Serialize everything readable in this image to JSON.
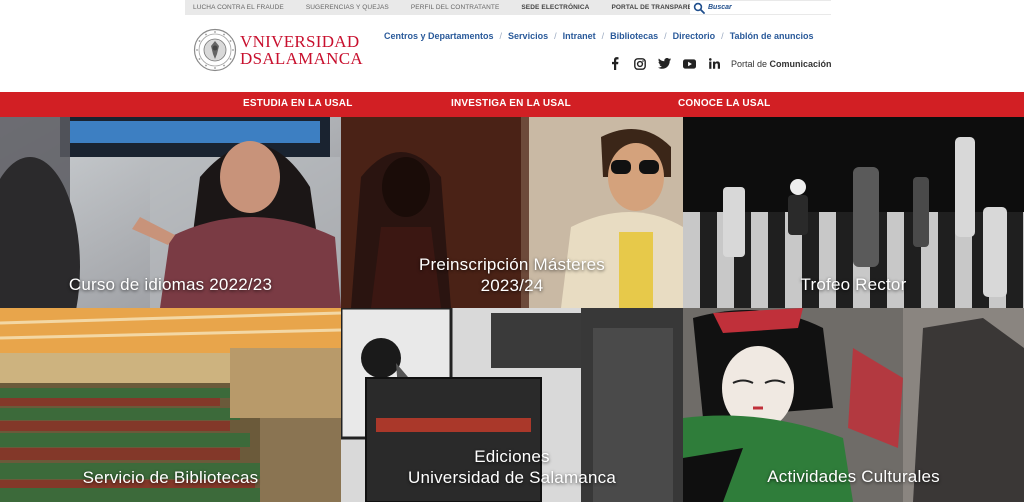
{
  "topbar": {
    "links": [
      "LUCHA CONTRA EL FRAUDE",
      "SUGERENCIAS Y QUEJAS",
      "PERFIL DEL CONTRATANTE",
      "SEDE ELECTRÓNICA",
      "PORTAL DE TRANSPARENCIA"
    ],
    "search_placeholder": "Buscar"
  },
  "logo": {
    "line1": "VNIVERSIDAD",
    "line2": "DSALAMANCA"
  },
  "main_nav": [
    "Centros y Departamentos",
    "Servicios",
    "Intranet",
    "Bibliotecas",
    "Directorio",
    "Tablón de anuncios"
  ],
  "socials": [
    "facebook-icon",
    "instagram-icon",
    "twitter-icon",
    "youtube-icon",
    "linkedin-icon"
  ],
  "portal": {
    "prefix": "Portal de",
    "bold": "Comunicación"
  },
  "red_nav": [
    "ESTUDIA EN LA USAL",
    "INVESTIGA EN LA USAL",
    "CONOCE LA USAL"
  ],
  "tiles": [
    {
      "line1": "Curso de idiomas 2022/23",
      "line2": ""
    },
    {
      "line1": "Preinscripción Másteres",
      "line2": "2023/24"
    },
    {
      "line1": "Trofeo Rector",
      "line2": ""
    },
    {
      "line1": "Servicio de Bibliotecas",
      "line2": ""
    },
    {
      "line1": "Ediciones",
      "line2": "Universidad de Salamanca"
    },
    {
      "line1": "Actividades Culturales",
      "line2": ""
    }
  ],
  "colors": {
    "brand_red": "#c8102e",
    "nav_red": "#d21f24",
    "link_blue": "#2a5a9a"
  }
}
